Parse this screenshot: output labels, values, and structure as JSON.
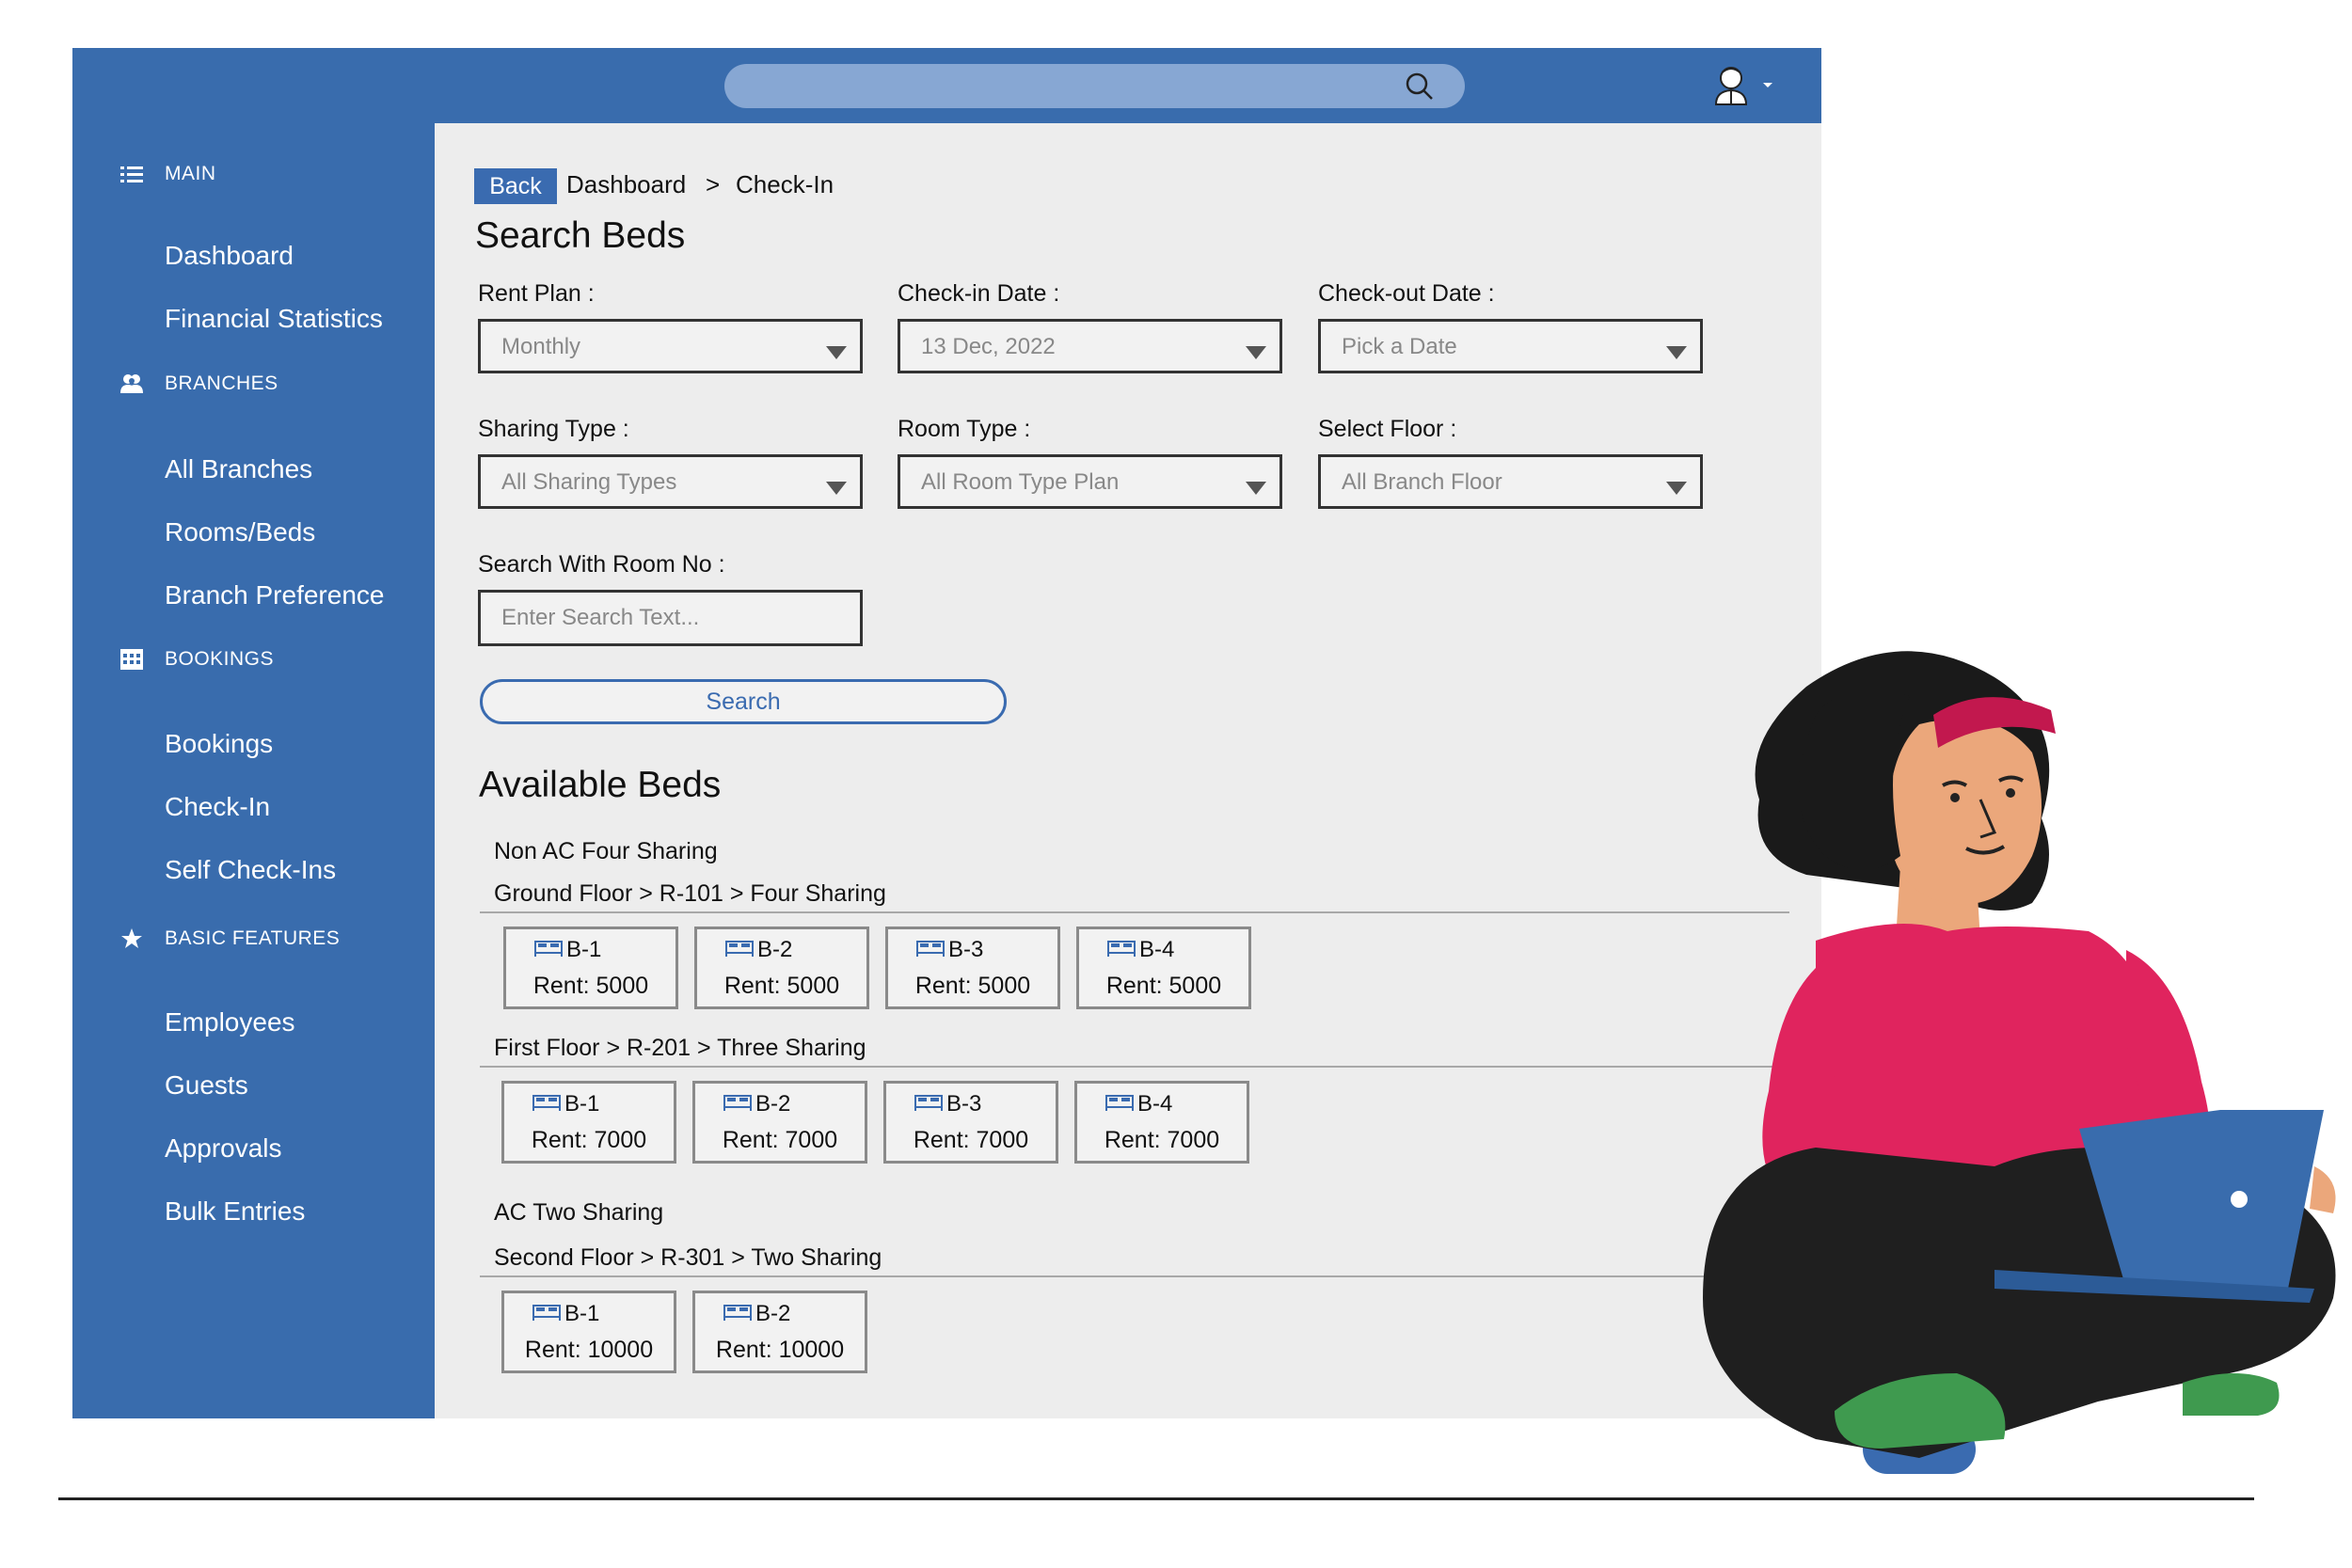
{
  "sidebar": {
    "sections": [
      {
        "title": "MAIN",
        "icon": "list-icon",
        "items": [
          "Dashboard",
          "Financial Statistics"
        ]
      },
      {
        "title": "BRANCHES",
        "icon": "users-icon",
        "items": [
          "All Branches",
          "Rooms/Beds",
          "Branch Preference"
        ]
      },
      {
        "title": "BOOKINGS",
        "icon": "calendar-grid-icon",
        "items": [
          "Bookings",
          "Check-In",
          "Self Check-Ins"
        ]
      },
      {
        "title": "BASIC FEATURES",
        "icon": "star-icon",
        "items": [
          "Employees",
          "Guests",
          "Approvals",
          "Bulk Entries"
        ]
      }
    ]
  },
  "header": {
    "search_icon": "search-icon",
    "user_icon": "user-avatar-icon"
  },
  "breadcrumb": {
    "back": "Back",
    "parent": "Dashboard",
    "separator": ">",
    "current": "Check-In"
  },
  "page_title": "Search Beds",
  "filters": {
    "rent_plan": {
      "label": "Rent Plan :",
      "value": "Monthly"
    },
    "checkin": {
      "label": "Check-in Date :",
      "value": "13 Dec, 2022"
    },
    "checkout": {
      "label": "Check-out Date :",
      "value": "Pick a Date"
    },
    "sharing": {
      "label": "Sharing Type :",
      "value": "All Sharing Types"
    },
    "room_type": {
      "label": "Room Type :",
      "value": "All Room Type Plan"
    },
    "floor": {
      "label": "Select Floor :",
      "value": "All Branch Floor"
    },
    "room_no": {
      "label": "Search With Room No :",
      "placeholder": "Enter Search Text..."
    }
  },
  "search_button": "Search",
  "available_title": "Available Beds",
  "groups": [
    {
      "name": "Non AC Four Sharing",
      "floors": [
        {
          "label": "Ground Floor > R-101 > Four Sharing",
          "beds": [
            {
              "name": "B-1",
              "rent": "Rent: 5000"
            },
            {
              "name": "B-2",
              "rent": "Rent: 5000"
            },
            {
              "name": "B-3",
              "rent": "Rent: 5000"
            },
            {
              "name": "B-4",
              "rent": "Rent: 5000"
            }
          ]
        },
        {
          "label": "First Floor > R-201 > Three Sharing",
          "beds": [
            {
              "name": "B-1",
              "rent": "Rent: 7000"
            },
            {
              "name": "B-2",
              "rent": "Rent: 7000"
            },
            {
              "name": "B-3",
              "rent": "Rent: 7000"
            },
            {
              "name": "B-4",
              "rent": "Rent: 7000"
            }
          ]
        }
      ]
    },
    {
      "name": "AC Two Sharing",
      "floors": [
        {
          "label": "Second Floor > R-301 > Two Sharing",
          "beds": [
            {
              "name": "B-1",
              "rent": "Rent: 10000"
            },
            {
              "name": "B-2",
              "rent": "Rent: 10000"
            }
          ]
        }
      ]
    }
  ],
  "colors": {
    "primary": "#396cad",
    "panel": "#ededed",
    "shirt": "#e0245e",
    "pants": "#1f1f1f",
    "shoes": "#3f9a4f",
    "skin": "#eba77b"
  }
}
